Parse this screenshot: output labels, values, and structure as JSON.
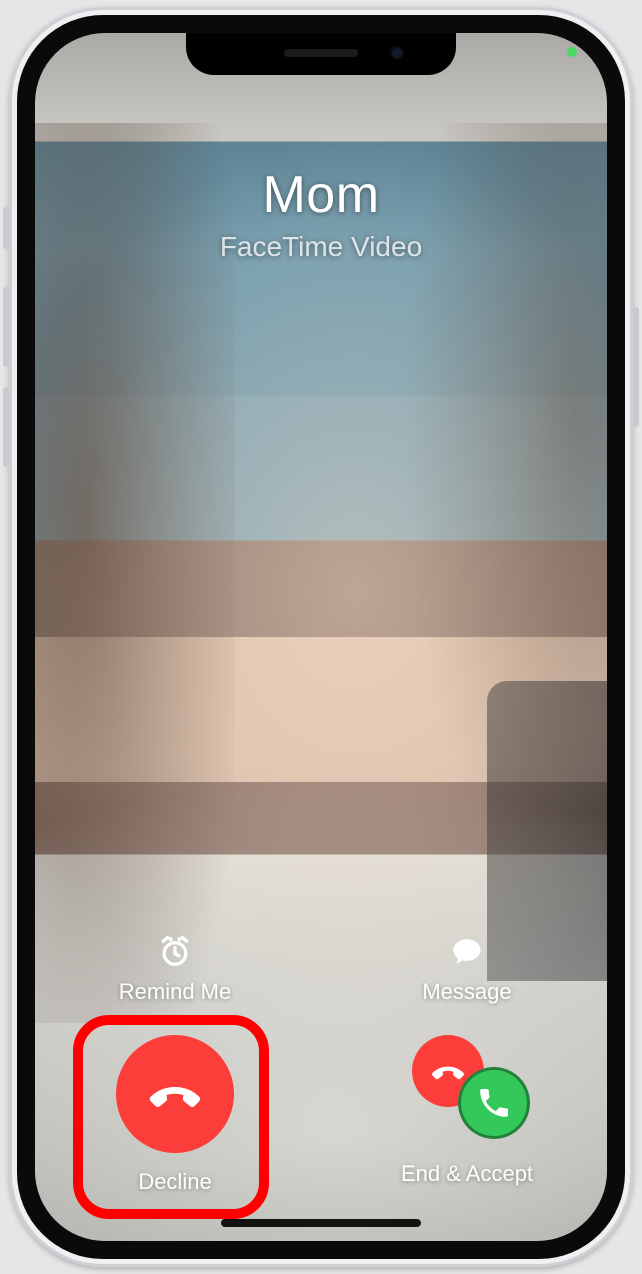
{
  "caller": {
    "name": "Mom",
    "subtitle": "FaceTime Video"
  },
  "actions": {
    "remind": {
      "label": "Remind Me",
      "icon": "alarm-clock-icon"
    },
    "message": {
      "label": "Message",
      "icon": "message-bubble-icon"
    },
    "decline": {
      "label": "Decline",
      "icon": "phone-hangup-icon"
    },
    "end_accept": {
      "label": "End & Accept",
      "icon_end": "phone-hangup-icon",
      "icon_accept": "phone-icon"
    }
  },
  "colors": {
    "decline_bg": "#fc3d39",
    "accept_bg": "#34c759",
    "status_dot": "#4cd964",
    "highlight_ring": "#ff0000"
  },
  "annotation": {
    "highlight_target": "decline"
  }
}
